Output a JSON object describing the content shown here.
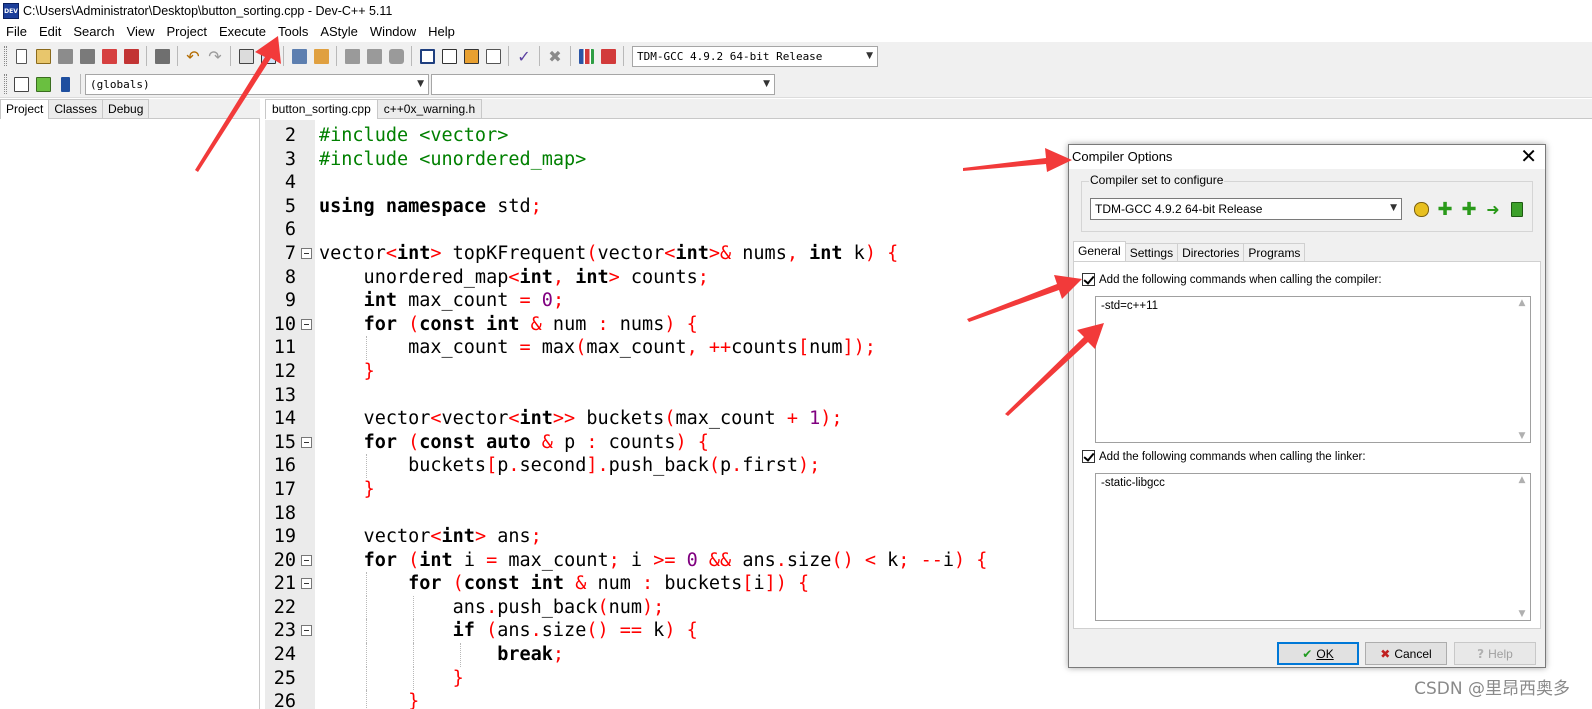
{
  "window": {
    "title": "C:\\Users\\Administrator\\Desktop\\button_sorting.cpp - Dev-C++ 5.11",
    "app_icon_text": "DEV"
  },
  "menu": [
    "File",
    "Edit",
    "Search",
    "View",
    "Project",
    "Execute",
    "Tools",
    "AStyle",
    "Window",
    "Help"
  ],
  "toolbar": {
    "compiler_select": "TDM-GCC 4.9.2 64-bit Release",
    "globals_select": "(globals)",
    "member_select": ""
  },
  "left_panel": {
    "tabs": [
      "Project",
      "Classes",
      "Debug"
    ]
  },
  "editor": {
    "tabs": [
      "button_sorting.cpp",
      "c++0x_warning.h"
    ],
    "lines": [
      {
        "n": "2",
        "fold": false,
        "guides": 0,
        "tokens": [
          [
            "pp",
            "#include <vector>"
          ]
        ]
      },
      {
        "n": "3",
        "fold": false,
        "guides": 0,
        "tokens": [
          [
            "pp",
            "#include <unordered_map>"
          ]
        ]
      },
      {
        "n": "4",
        "fold": false,
        "guides": 0,
        "tokens": []
      },
      {
        "n": "5",
        "fold": false,
        "guides": 0,
        "tokens": [
          [
            "kw",
            "using namespace"
          ],
          [
            "id",
            " std"
          ],
          [
            "sym",
            ";"
          ]
        ]
      },
      {
        "n": "6",
        "fold": false,
        "guides": 0,
        "tokens": []
      },
      {
        "n": "7",
        "fold": true,
        "guides": 0,
        "tokens": [
          [
            "id",
            "vector"
          ],
          [
            "sym",
            "<"
          ],
          [
            "kw",
            "int"
          ],
          [
            "sym",
            ">"
          ],
          [
            "id",
            " topKFrequent"
          ],
          [
            "sym",
            "("
          ],
          [
            "id",
            "vector"
          ],
          [
            "sym",
            "<"
          ],
          [
            "kw",
            "int"
          ],
          [
            "sym",
            ">&"
          ],
          [
            "id",
            " nums"
          ],
          [
            "sym",
            ","
          ],
          [
            "id",
            " "
          ],
          [
            "kw",
            "int"
          ],
          [
            "id",
            " k"
          ],
          [
            "sym",
            ")"
          ],
          [
            "id",
            " "
          ],
          [
            "sym",
            "{"
          ]
        ]
      },
      {
        "n": "8",
        "fold": false,
        "guides": 0,
        "tokens": [
          [
            "id",
            "    unordered_map"
          ],
          [
            "sym",
            "<"
          ],
          [
            "kw",
            "int"
          ],
          [
            "sym",
            ","
          ],
          [
            "id",
            " "
          ],
          [
            "kw",
            "int"
          ],
          [
            "sym",
            ">"
          ],
          [
            "id",
            " counts"
          ],
          [
            "sym",
            ";"
          ]
        ]
      },
      {
        "n": "9",
        "fold": false,
        "guides": 0,
        "tokens": [
          [
            "id",
            "    "
          ],
          [
            "kw",
            "int"
          ],
          [
            "id",
            " max_count "
          ],
          [
            "sym",
            "="
          ],
          [
            "id",
            " "
          ],
          [
            "num",
            "0"
          ],
          [
            "sym",
            ";"
          ]
        ]
      },
      {
        "n": "10",
        "fold": true,
        "guides": 0,
        "tokens": [
          [
            "id",
            "    "
          ],
          [
            "kw",
            "for"
          ],
          [
            "id",
            " "
          ],
          [
            "sym",
            "("
          ],
          [
            "kw",
            "const int"
          ],
          [
            "id",
            " "
          ],
          [
            "sym",
            "&"
          ],
          [
            "id",
            " num "
          ],
          [
            "sym",
            ":"
          ],
          [
            "id",
            " nums"
          ],
          [
            "sym",
            ")"
          ],
          [
            "id",
            " "
          ],
          [
            "sym",
            "{"
          ]
        ]
      },
      {
        "n": "11",
        "fold": false,
        "guides": 1,
        "tokens": [
          [
            "id",
            "        max_count "
          ],
          [
            "sym",
            "="
          ],
          [
            "id",
            " max"
          ],
          [
            "sym",
            "("
          ],
          [
            "id",
            "max_count"
          ],
          [
            "sym",
            ","
          ],
          [
            "id",
            " "
          ],
          [
            "sym",
            "++"
          ],
          [
            "id",
            "counts"
          ],
          [
            "sym",
            "["
          ],
          [
            "id",
            "num"
          ],
          [
            "sym",
            "]);"
          ]
        ]
      },
      {
        "n": "12",
        "fold": false,
        "guides": 0,
        "tokens": [
          [
            "id",
            "    "
          ],
          [
            "sym",
            "}"
          ]
        ]
      },
      {
        "n": "13",
        "fold": false,
        "guides": 0,
        "tokens": []
      },
      {
        "n": "14",
        "fold": false,
        "guides": 0,
        "tokens": [
          [
            "id",
            "    vector"
          ],
          [
            "sym",
            "<"
          ],
          [
            "id",
            "vector"
          ],
          [
            "sym",
            "<"
          ],
          [
            "kw",
            "int"
          ],
          [
            "sym",
            ">>"
          ],
          [
            "id",
            " buckets"
          ],
          [
            "sym",
            "("
          ],
          [
            "id",
            "max_count "
          ],
          [
            "sym",
            "+"
          ],
          [
            "id",
            " "
          ],
          [
            "num",
            "1"
          ],
          [
            "sym",
            ");"
          ]
        ]
      },
      {
        "n": "15",
        "fold": true,
        "guides": 0,
        "tokens": [
          [
            "id",
            "    "
          ],
          [
            "kw",
            "for"
          ],
          [
            "id",
            " "
          ],
          [
            "sym",
            "("
          ],
          [
            "kw",
            "const auto"
          ],
          [
            "id",
            " "
          ],
          [
            "sym",
            "&"
          ],
          [
            "id",
            " p "
          ],
          [
            "sym",
            ":"
          ],
          [
            "id",
            " counts"
          ],
          [
            "sym",
            ")"
          ],
          [
            "id",
            " "
          ],
          [
            "sym",
            "{"
          ]
        ]
      },
      {
        "n": "16",
        "fold": false,
        "guides": 1,
        "tokens": [
          [
            "id",
            "        buckets"
          ],
          [
            "sym",
            "["
          ],
          [
            "id",
            "p"
          ],
          [
            "sym",
            "."
          ],
          [
            "id",
            "second"
          ],
          [
            "sym",
            "]."
          ],
          [
            "id",
            "push_back"
          ],
          [
            "sym",
            "("
          ],
          [
            "id",
            "p"
          ],
          [
            "sym",
            "."
          ],
          [
            "id",
            "first"
          ],
          [
            "sym",
            ");"
          ]
        ]
      },
      {
        "n": "17",
        "fold": false,
        "guides": 0,
        "tokens": [
          [
            "id",
            "    "
          ],
          [
            "sym",
            "}"
          ]
        ]
      },
      {
        "n": "18",
        "fold": false,
        "guides": 0,
        "tokens": []
      },
      {
        "n": "19",
        "fold": false,
        "guides": 0,
        "tokens": [
          [
            "id",
            "    vector"
          ],
          [
            "sym",
            "<"
          ],
          [
            "kw",
            "int"
          ],
          [
            "sym",
            ">"
          ],
          [
            "id",
            " ans"
          ],
          [
            "sym",
            ";"
          ]
        ]
      },
      {
        "n": "20",
        "fold": true,
        "guides": 0,
        "tokens": [
          [
            "id",
            "    "
          ],
          [
            "kw",
            "for"
          ],
          [
            "id",
            " "
          ],
          [
            "sym",
            "("
          ],
          [
            "kw",
            "int"
          ],
          [
            "id",
            " i "
          ],
          [
            "sym",
            "="
          ],
          [
            "id",
            " max_count"
          ],
          [
            "sym",
            ";"
          ],
          [
            "id",
            " i "
          ],
          [
            "sym",
            ">="
          ],
          [
            "id",
            " "
          ],
          [
            "num",
            "0"
          ],
          [
            "id",
            " "
          ],
          [
            "sym",
            "&&"
          ],
          [
            "id",
            " ans"
          ],
          [
            "sym",
            "."
          ],
          [
            "id",
            "size"
          ],
          [
            "sym",
            "()"
          ],
          [
            "id",
            " "
          ],
          [
            "sym",
            "<"
          ],
          [
            "id",
            " k"
          ],
          [
            "sym",
            ";"
          ],
          [
            "id",
            " "
          ],
          [
            "sym",
            "--"
          ],
          [
            "id",
            "i"
          ],
          [
            "sym",
            ")"
          ],
          [
            "id",
            " "
          ],
          [
            "sym",
            "{"
          ]
        ]
      },
      {
        "n": "21",
        "fold": true,
        "guides": 1,
        "tokens": [
          [
            "id",
            "        "
          ],
          [
            "kw",
            "for"
          ],
          [
            "id",
            " "
          ],
          [
            "sym",
            "("
          ],
          [
            "kw",
            "const int"
          ],
          [
            "id",
            " "
          ],
          [
            "sym",
            "&"
          ],
          [
            "id",
            " num "
          ],
          [
            "sym",
            ":"
          ],
          [
            "id",
            " buckets"
          ],
          [
            "sym",
            "["
          ],
          [
            "id",
            "i"
          ],
          [
            "sym",
            "])"
          ],
          [
            "id",
            " "
          ],
          [
            "sym",
            "{"
          ]
        ]
      },
      {
        "n": "22",
        "fold": false,
        "guides": 2,
        "tokens": [
          [
            "id",
            "            ans"
          ],
          [
            "sym",
            "."
          ],
          [
            "id",
            "push_back"
          ],
          [
            "sym",
            "("
          ],
          [
            "id",
            "num"
          ],
          [
            "sym",
            ");"
          ]
        ]
      },
      {
        "n": "23",
        "fold": true,
        "guides": 2,
        "tokens": [
          [
            "id",
            "            "
          ],
          [
            "kw",
            "if"
          ],
          [
            "id",
            " "
          ],
          [
            "sym",
            "("
          ],
          [
            "id",
            "ans"
          ],
          [
            "sym",
            "."
          ],
          [
            "id",
            "size"
          ],
          [
            "sym",
            "()"
          ],
          [
            "id",
            " "
          ],
          [
            "sym",
            "=="
          ],
          [
            "id",
            " k"
          ],
          [
            "sym",
            ")"
          ],
          [
            "id",
            " "
          ],
          [
            "sym",
            "{"
          ]
        ]
      },
      {
        "n": "24",
        "fold": false,
        "guides": 3,
        "tokens": [
          [
            "id",
            "                "
          ],
          [
            "kw",
            "break"
          ],
          [
            "sym",
            ";"
          ]
        ]
      },
      {
        "n": "25",
        "fold": false,
        "guides": 2,
        "tokens": [
          [
            "id",
            "            "
          ],
          [
            "sym",
            "}"
          ]
        ]
      },
      {
        "n": "26",
        "fold": false,
        "guides": 1,
        "tokens": [
          [
            "id",
            "        "
          ],
          [
            "sym",
            "}"
          ]
        ]
      }
    ]
  },
  "dialog": {
    "title": "Compiler Options",
    "group_label": "Compiler set to configure",
    "compiler_select": "TDM-GCC 4.9.2 64-bit Release",
    "tabs": [
      "General",
      "Settings",
      "Directories",
      "Programs"
    ],
    "compiler_check_label": "Add the following commands when calling the compiler:",
    "compiler_commands": "-std=c++11",
    "linker_check_label": "Add the following commands when calling the linker:",
    "linker_commands": "-static-libgcc",
    "ok_label": "OK",
    "cancel_label": "Cancel",
    "help_label": "Help"
  },
  "watermark": "CSDN @里昂西奥多",
  "colors": {
    "annotation_arrow": "#f23a3a",
    "preprocessor": "#008000",
    "symbol": "#ff0000",
    "number": "#800080"
  }
}
